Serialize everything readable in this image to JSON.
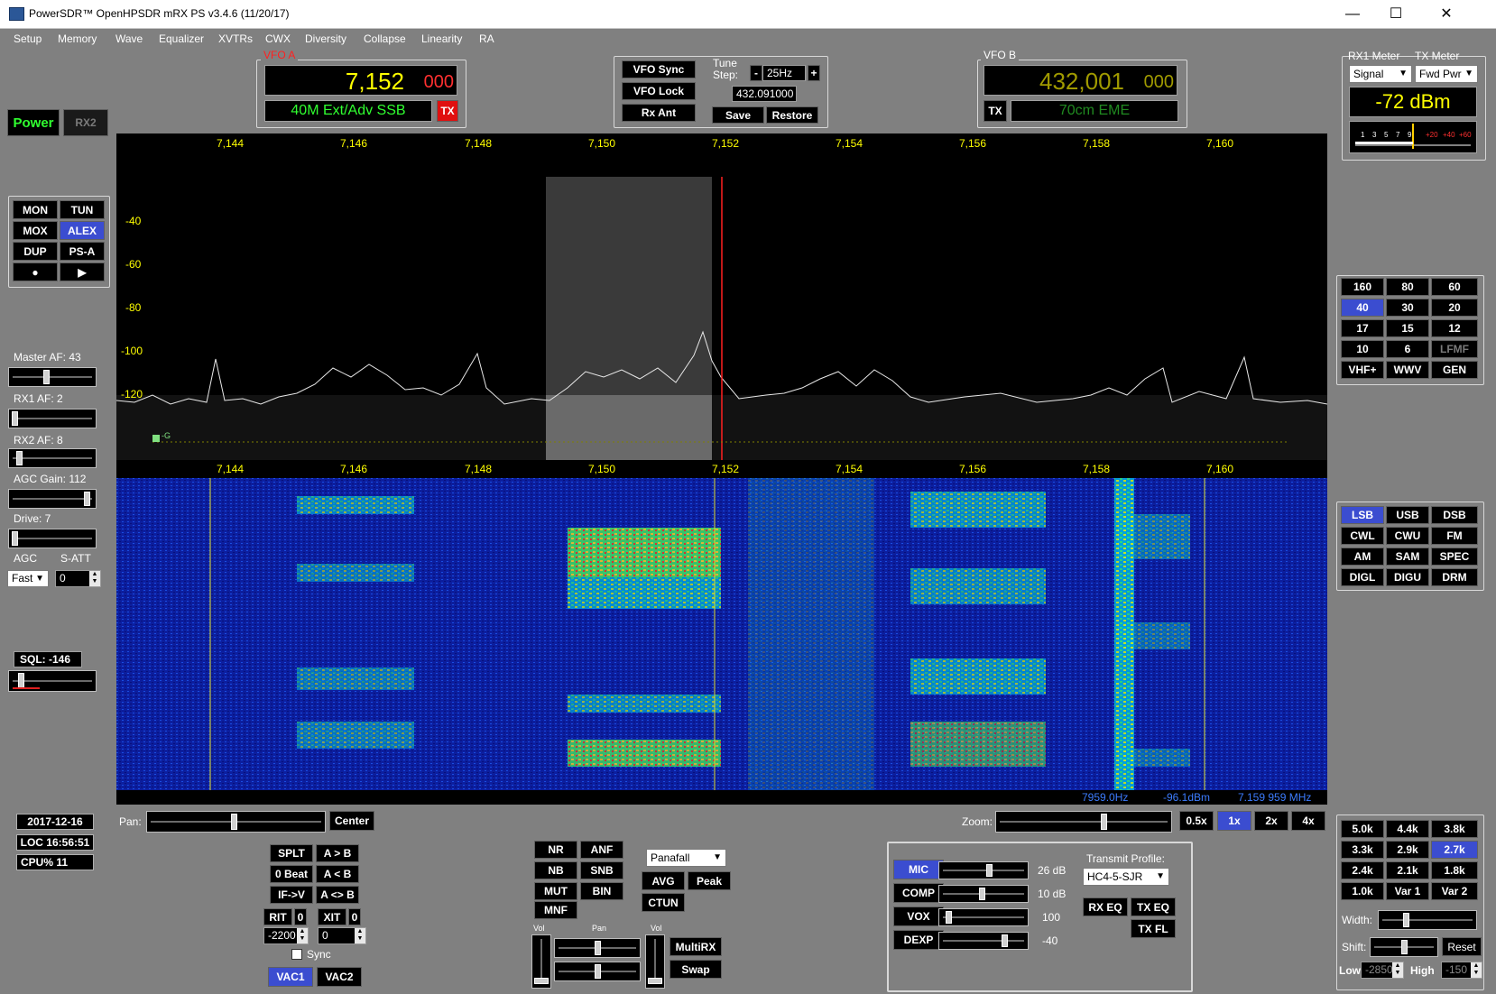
{
  "window": {
    "title": "PowerSDR™ OpenHPSDR mRX PS v3.4.6 (11/20/17)",
    "minimize": "—",
    "maximize": "☐",
    "close": "✕"
  },
  "menu": [
    "Setup",
    "Memory",
    "Wave",
    "Equalizer",
    "XVTRs",
    "CWX",
    "Diversity",
    "Collapse",
    "Linearity",
    "RA"
  ],
  "power": {
    "power_label": "Power",
    "rx2_label": "RX2"
  },
  "vfo_a": {
    "label": "VFO A",
    "freq_main": "7,152",
    "freq_sub": "000",
    "mode_band": "40M Ext/Adv SSB",
    "tx_label": "TX"
  },
  "vfo_center": {
    "sync": "VFO Sync",
    "lock": "VFO Lock",
    "rx_ant": "Rx Ant",
    "tune_step_label": "Tune Step:",
    "minus": "-",
    "plus": "+",
    "step_value": "25Hz",
    "mem_freq": "432.091000",
    "save": "Save",
    "restore": "Restore"
  },
  "vfo_b": {
    "label": "VFO B",
    "freq_main": "432,001",
    "freq_sub": "000",
    "tx_label": "TX",
    "mode_band": "70cm EME"
  },
  "meter": {
    "rx1_label": "RX1 Meter",
    "tx_label": "TX Meter",
    "rx1_select": "Signal",
    "tx_select": "Fwd Pwr",
    "reading": "-72 dBm",
    "scale": [
      "1",
      "3",
      "5",
      "7",
      "9",
      "+20",
      "+40",
      "+60"
    ]
  },
  "mode_buttons": {
    "mon": "MON",
    "tun": "TUN",
    "mox": "MOX",
    "alex": "ALEX",
    "dup": "DUP",
    "psa": "PS-A",
    "rec": "●",
    "play": "▶"
  },
  "audio": {
    "master_af": "Master AF:  43",
    "rx1_af": "RX1 AF:  2",
    "rx2_af": "RX2 AF:  8",
    "agc_gain": "AGC Gain:  112",
    "drive": "Drive:  7",
    "agc": "AGC",
    "satt": "S-ATT",
    "agc_mode": "Fast",
    "satt_value": "0",
    "sql": "SQL:  -146"
  },
  "panadapter": {
    "freq_ticks": [
      "7,144",
      "7,146",
      "7,148",
      "7,150",
      "7,152",
      "7,154",
      "7,156",
      "7,158",
      "7,160"
    ],
    "db_ticks": [
      "-40",
      "-60",
      "-80",
      "-100",
      "-120"
    ],
    "marker_label": "-G"
  },
  "status_bar": {
    "cursor_hz": "7959.0Hz",
    "cursor_db": "-96.1dBm",
    "cursor_mhz": "7.159 959 MHz"
  },
  "bands": [
    "160",
    "80",
    "60",
    "40",
    "30",
    "20",
    "17",
    "15",
    "12",
    "10",
    "6",
    "LFMF",
    "VHF+",
    "WWV",
    "GEN"
  ],
  "modes": [
    "LSB",
    "USB",
    "DSB",
    "CWL",
    "CWU",
    "FM",
    "AM",
    "SAM",
    "SPEC",
    "DIGL",
    "DIGU",
    "DRM"
  ],
  "filters": [
    "5.0k",
    "4.4k",
    "3.8k",
    "3.3k",
    "2.9k",
    "2.7k",
    "2.4k",
    "2.1k",
    "1.8k",
    "1.0k",
    "Var 1",
    "Var 2"
  ],
  "filter_ctrl": {
    "width": "Width:",
    "shift": "Shift:",
    "reset": "Reset",
    "low_label": "Low",
    "low_value": "-2850",
    "high_label": "High",
    "high_value": "-150"
  },
  "clock": {
    "date": "2017-12-16",
    "loc": "LOC 16:56:51",
    "cpu": "CPU%  11"
  },
  "pan_zoom": {
    "pan_label": "Pan:",
    "center": "Center",
    "zoom_label": "Zoom:",
    "z05": "0.5x",
    "z1": "1x",
    "z2": "2x",
    "z4": "4x"
  },
  "split": {
    "splt": "SPLT",
    "atob": "A > B",
    "zbeat": "0 Beat",
    "btoa": "A < B",
    "ifv": "IF->V",
    "swapab": "A <> B",
    "rit": "RIT",
    "rit_val": "0",
    "xit": "XIT",
    "xit_val": "0",
    "rit_offset": "-2200",
    "xit_offset": "0",
    "sync": "Sync",
    "vac1": "VAC1",
    "vac2": "VAC2"
  },
  "dsp": {
    "nr": "NR",
    "anf": "ANF",
    "nb": "NB",
    "snb": "SNB",
    "mut": "MUT",
    "bin": "BIN",
    "mnf": "MNF",
    "display_mode": "Panafall",
    "avg": "AVG",
    "peak": "Peak",
    "ctun": "CTUN",
    "vol": "Vol",
    "pan": "Pan",
    "vol2": "Vol",
    "multirx": "MultiRX",
    "swap": "Swap"
  },
  "tx": {
    "mic": "MIC",
    "mic_val": "26 dB",
    "comp": "COMP",
    "comp_val": "10 dB",
    "vox": "VOX",
    "vox_val": "100",
    "dexp": "DEXP",
    "dexp_val": "-40",
    "profile_label": "Transmit Profile:",
    "profile": "HC4-5-SJR",
    "rx_eq": "RX EQ",
    "tx_eq": "TX EQ",
    "tx_fl": "TX FL"
  },
  "colors": {
    "background": "#808080",
    "selected": "#3b4dd0",
    "freq_yellow": "#ffff00",
    "vfo_b_text": "#a09a00",
    "mode_green": "#30ff30",
    "status_blue": "#3c7cff"
  }
}
